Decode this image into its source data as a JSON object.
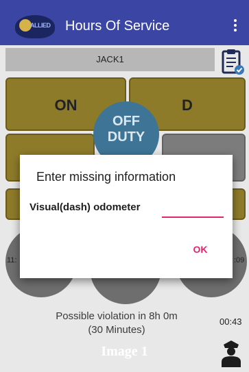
{
  "appbar": {
    "logo_text": "ALLIED",
    "title": "Hours Of Service",
    "menu_icon": "overflow-menu-icon"
  },
  "driver": {
    "name": "JACK1",
    "logs_icon": "clipboard-check-icon"
  },
  "duty": {
    "on_label": "ON",
    "d_label": "D",
    "off_duty_line1": "OFF",
    "off_duty_line2": "DUTY"
  },
  "timers": {
    "left_value": "11:",
    "right_value": ":09"
  },
  "status": {
    "violation_line1": "Possible violation in 8h 0m",
    "violation_line2": "(30 Minutes)",
    "violation_time": "00:43",
    "image_label": "Image 1",
    "officer_icon": "officer-icon"
  },
  "dialog": {
    "title": "Enter missing information",
    "field_label": "Visual(dash) odometer",
    "field_value": "",
    "ok_label": "OK"
  },
  "colors": {
    "appbar": "#3b45a3",
    "duty_gold": "#8e7b2a",
    "off_duty": "#3e7596",
    "accent_pink": "#e4236b"
  }
}
